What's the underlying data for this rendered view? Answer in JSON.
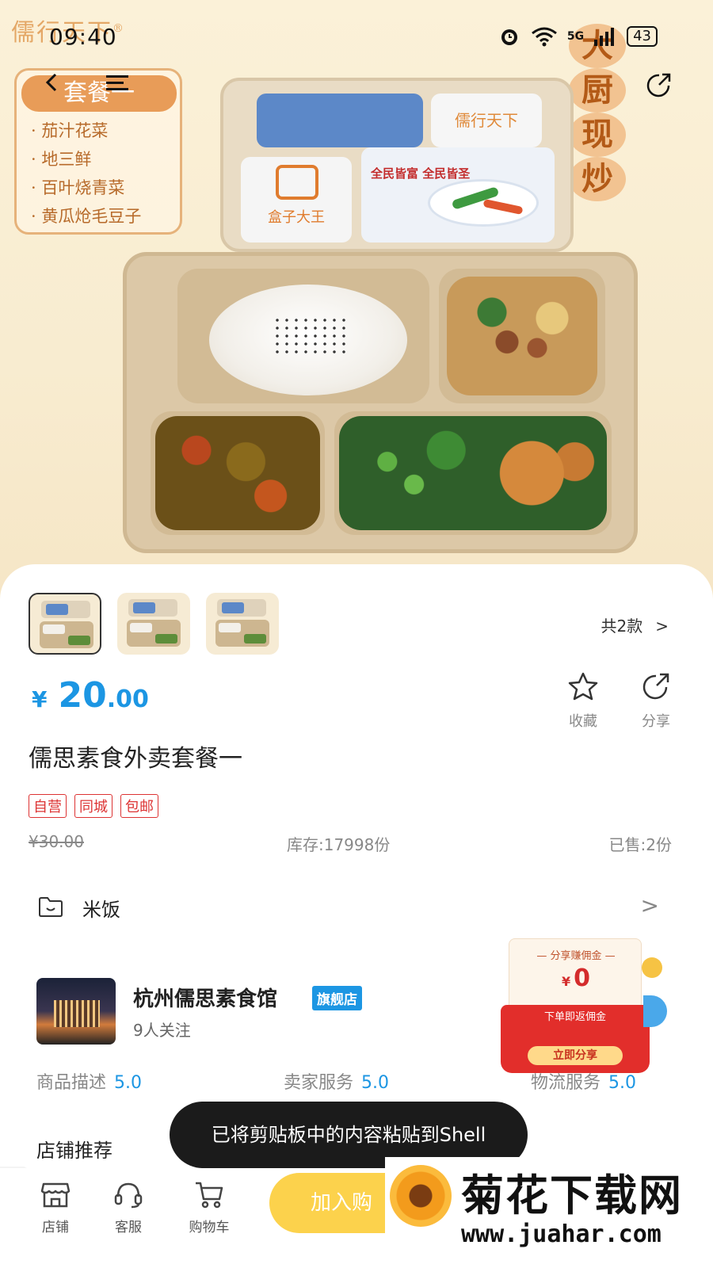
{
  "status_bar": {
    "time": "09:40",
    "network": "5G",
    "battery": "43"
  },
  "image": {
    "brand": "儒行天下",
    "brand_mark": "®",
    "menu_title": "套餐一",
    "menu_items": [
      "茄汁花菜",
      "地三鲜",
      "百叶烧青菜",
      "黄瓜炝毛豆子"
    ],
    "chef_badge": [
      "大",
      "厨",
      "现",
      "炒"
    ],
    "lid_brand": "儒行天下",
    "lid_box_king": "盒子大王",
    "lid_slogan": "全民皆富 全民皆圣"
  },
  "icons": {
    "back": "back-arrow-icon",
    "menu": "menu-icon",
    "share": "share-icon",
    "favorite": "star-icon",
    "store": "store-icon",
    "service": "headset-icon",
    "cart": "cart-icon"
  },
  "gallery": {
    "variants_label": "共2款",
    "chevron": ">"
  },
  "product": {
    "currency": "¥",
    "price_int": "20",
    "price_dec": ".00",
    "title": "儒思素食外卖套餐一",
    "tags": [
      "自营",
      "同城",
      "包邮"
    ],
    "original_price": "¥30.00",
    "stock": "库存:17998份",
    "sold": "已售:2份",
    "favorite_label": "收藏",
    "share_label": "分享"
  },
  "option_row": {
    "label": "米饭",
    "chevron": ">"
  },
  "store": {
    "name": "杭州儒思素食馆",
    "badge": "旗舰店",
    "followers": "9人关注",
    "ratings": [
      {
        "label": "商品描述",
        "value": "5.0"
      },
      {
        "label": "卖家服务",
        "value": "5.0"
      },
      {
        "label": "物流服务",
        "value": "5.0"
      }
    ],
    "recommend_title": "店铺推荐"
  },
  "promo": {
    "title": "分享赚佣金",
    "currency": "¥",
    "amount": "0",
    "subtitle": "下单即返佣金",
    "button": "立即分享"
  },
  "toast": {
    "message": "已将剪贴板中的内容粘贴到Shell"
  },
  "bottom_bar": {
    "store_label": "店铺",
    "service_label": "客服",
    "cart_label": "购物车",
    "add_to_cart": "加入购"
  },
  "watermark": {
    "title": "菊花下载网",
    "url": "www.juahar.com"
  },
  "colors": {
    "accent": "#1c96e3",
    "tag_red": "#dd3333",
    "cart_yellow": "#fcd24c",
    "toast_bg": "#1b1b1b"
  }
}
